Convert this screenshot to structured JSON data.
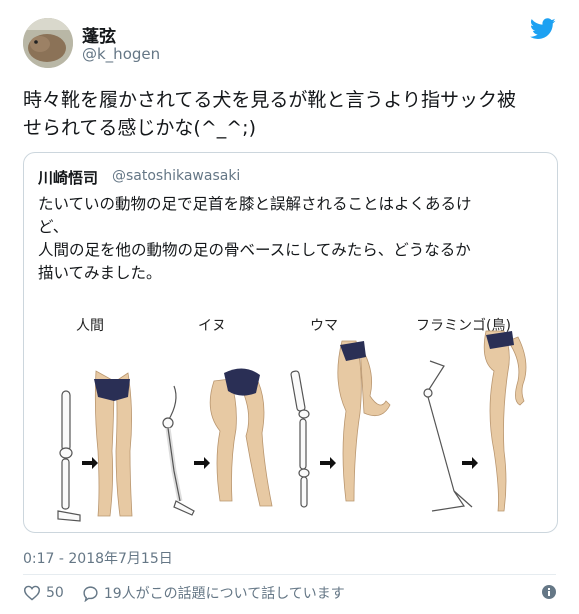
{
  "author": {
    "name": "蓬弦",
    "handle": "@k_hogen"
  },
  "tweet_lines": [
    "時々靴を履かされてる犬を見るが靴と言うより指サック被",
    "せられてる感じかな(^_^;)"
  ],
  "quoted": {
    "name": "川崎悟司",
    "handle": "@satoshikawasaki",
    "lines": [
      "たいていの動物の足で足首を膝と誤解されることはよくあるけ",
      "ど、",
      "人間の足を他の動物の足の骨ベースにしてみたら、どうなるか",
      "描いてみました。"
    ],
    "figure_labels": [
      "人間",
      "イヌ",
      "ウマ",
      "フラミンゴ(鳥)"
    ]
  },
  "timestamp": "0:17 - 2018年7月15日",
  "likes": "50",
  "talking": "19人がこの話題について話しています",
  "colors": {
    "twitter_blue": "#1da1f2",
    "gray": "#657786",
    "skin": "#e7c9a3",
    "briefs": "#2a2f55"
  },
  "icons": [
    "twitter-bird-icon",
    "heart-icon",
    "comment-icon",
    "info-icon"
  ]
}
